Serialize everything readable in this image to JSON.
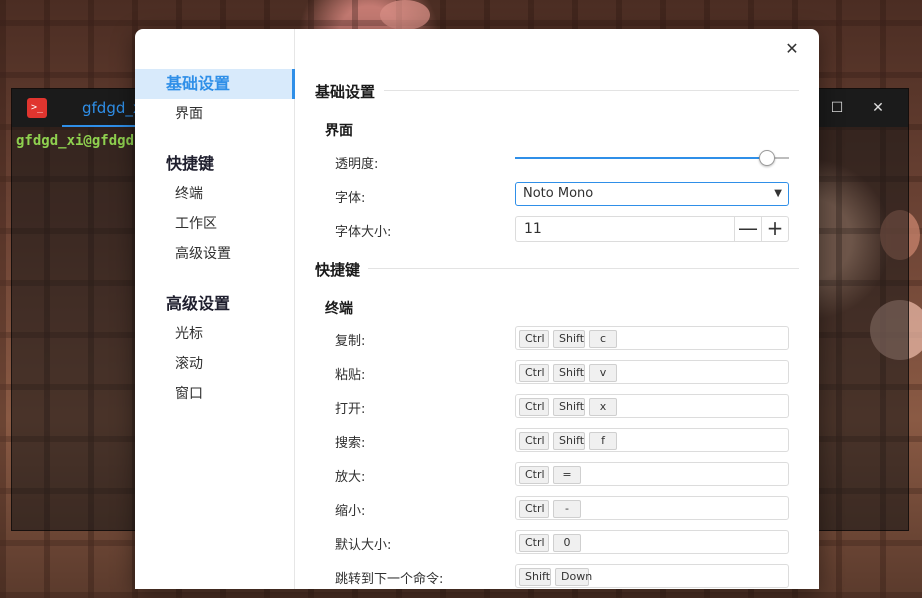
{
  "terminal": {
    "tab_title": "gfdgd_xi",
    "prompt": "gfdgd_xi@gfdgd",
    "logo_text": ">_",
    "maximize_glyph": "☐",
    "close_glyph": "✕"
  },
  "dialog": {
    "close_glyph": "✕",
    "sidebar": {
      "groups": [
        {
          "label": "基础设置",
          "items": [
            "界面"
          ]
        },
        {
          "label": "快捷键",
          "items": [
            "终端",
            "工作区",
            "高级设置"
          ]
        },
        {
          "label": "高级设置",
          "items": [
            "光标",
            "滚动",
            "窗口"
          ]
        }
      ]
    },
    "sections": {
      "basic": {
        "title": "基础设置",
        "interface": {
          "title": "界面",
          "opacity_label": "透明度:",
          "opacity_value": 0.92,
          "font_label": "字体:",
          "font_value": "Noto Mono",
          "font_size_label": "字体大小:",
          "font_size_value": "11",
          "minus_glyph": "—",
          "plus_glyph": "+"
        }
      },
      "shortcuts": {
        "title": "快捷键",
        "terminal": {
          "title": "终端",
          "rows": [
            {
              "label": "复制:",
              "keys": [
                "Ctrl",
                "Shift",
                "c"
              ]
            },
            {
              "label": "粘贴:",
              "keys": [
                "Ctrl",
                "Shift",
                "v"
              ]
            },
            {
              "label": "打开:",
              "keys": [
                "Ctrl",
                "Shift",
                "x"
              ]
            },
            {
              "label": "搜索:",
              "keys": [
                "Ctrl",
                "Shift",
                "f"
              ]
            },
            {
              "label": "放大:",
              "keys": [
                "Ctrl",
                "="
              ]
            },
            {
              "label": "缩小:",
              "keys": [
                "Ctrl",
                "-"
              ]
            },
            {
              "label": "默认大小:",
              "keys": [
                "Ctrl",
                "0"
              ]
            },
            {
              "label": "跳转到下一个命令:",
              "keys": [
                "Shift",
                "Down"
              ]
            }
          ]
        }
      }
    }
  },
  "colors": {
    "accent": "#2f8fe8",
    "nav_active_bg": "#d8eafb",
    "prompt_green": "#8fd14f"
  }
}
